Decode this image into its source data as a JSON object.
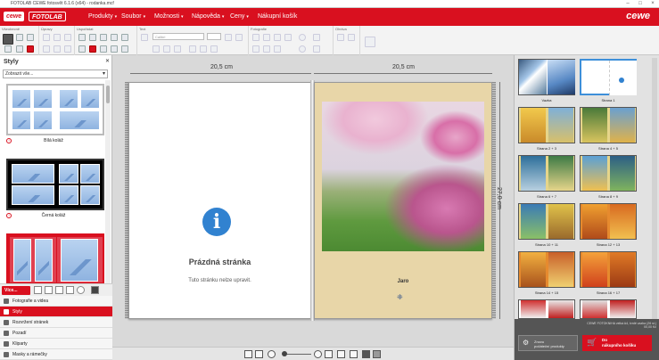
{
  "window": {
    "title": "FOTOLAB CEWE fotosvět 6.1.6 (x64) - rodanka.mcf"
  },
  "menubar": {
    "logo_small": "cewe",
    "logo_app": "FOTOLAB",
    "brand": "cewe",
    "items": [
      "Produkty",
      "Soubor",
      "Možnosti",
      "Nápověda",
      "Ceny",
      "Nákupní košík"
    ]
  },
  "ribbon": {
    "groups": [
      "Všeobecně",
      "Úpravy",
      "Uspořádat",
      "Text",
      "Fotografie",
      "Ohniva"
    ],
    "font_placeholder": "Calibri"
  },
  "left_panel": {
    "title": "Styly",
    "select_value": "Zobrazit vše...",
    "templates": [
      {
        "label": "Bílá koláž"
      },
      {
        "label": "Černá koláž"
      }
    ],
    "more_button": "Více...",
    "nav": [
      "Fotografie a videa",
      "Styly",
      "Rozvržení stránek",
      "Pozadí",
      "Kliparty",
      "Masky a rámečky"
    ],
    "active_nav": "Styly"
  },
  "workspace": {
    "left_width": "20,5 cm",
    "right_width": "20,5 cm",
    "height": "27,0 cm",
    "empty_title": "Prázdná stránka",
    "empty_sub": "Tuto stránku nelze upravit.",
    "page_caption": "Jaro",
    "info_icon": "i"
  },
  "right_panel": {
    "thumbs": [
      "Vazba",
      "Strana 1",
      "Strana 2 + 3",
      "Strana 4 + 5",
      "Strana 6 + 7",
      "Strana 8 + 9",
      "Strana 10 + 11",
      "Strana 12 + 13",
      "Strana 14 + 15",
      "Strana 16 + 17"
    ],
    "info_line1": "CEWE FOTOKNIHA velká A4, tvrdé vazba (26 st.)",
    "info_line2": "00,00 Kč",
    "create_line1": "Znovu",
    "create_line2": "počáteční produkty",
    "buy_line1": "Do",
    "buy_line2": "nákupního košíku"
  },
  "colors": {
    "brand_red": "#d9101f",
    "accent_blue": "#3d8fd9"
  }
}
